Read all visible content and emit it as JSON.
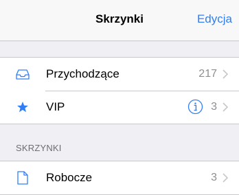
{
  "navbar": {
    "title": "Skrzynki",
    "edit_label": "Edycja"
  },
  "colors": {
    "accent": "#2f7ef6",
    "background": "#efeff4",
    "secondary_text": "#8e8e93",
    "separator": "#c8c7cc"
  },
  "mailboxes": [
    {
      "label": "Przychodzące",
      "count": "217",
      "icon": "inbox-tray-icon"
    },
    {
      "label": "VIP",
      "count": "3",
      "icon": "star-icon",
      "info_icon": "info-icon"
    }
  ],
  "sections": {
    "header": "SKRZYNKI"
  },
  "folders": [
    {
      "label": "Robocze",
      "count": "3",
      "icon": "document-icon"
    }
  ]
}
